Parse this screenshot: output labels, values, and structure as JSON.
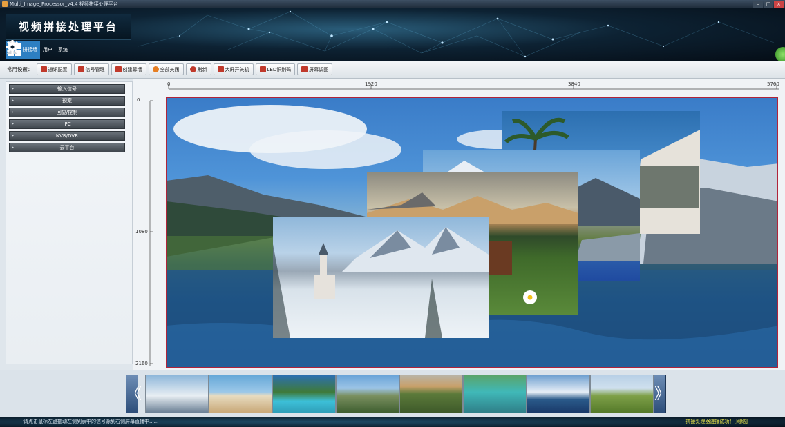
{
  "window": {
    "title": "Multi_Image_Processor_v4.4 视频拼接处理平台",
    "controls": [
      "–",
      "□",
      "×"
    ]
  },
  "header": {
    "brand": "视频拼接处理平台",
    "tabs": [
      {
        "label": "拼接墙",
        "icon": "grid-icon",
        "active": true
      },
      {
        "label": "用户",
        "icon": "user-icon",
        "active": false
      },
      {
        "label": "系统",
        "icon": "gear-icon",
        "active": false
      }
    ]
  },
  "toolbar": {
    "label": "常用设置：",
    "buttons": [
      {
        "label": "通讯配置",
        "icon": "comm-icon",
        "color": "#c0392b"
      },
      {
        "label": "信号管理",
        "icon": "signal-icon",
        "color": "#c0392b"
      },
      {
        "label": "创建幕墙",
        "icon": "wall-icon",
        "color": "#c0392b"
      },
      {
        "label": "全部关闭",
        "icon": "power-icon",
        "color": "#e67e22"
      },
      {
        "label": "刷新",
        "icon": "refresh-icon",
        "color": "#c0392b"
      },
      {
        "label": "大屏开关机",
        "icon": "screen-power-icon",
        "color": "#c0392b"
      },
      {
        "label": "LED识别码",
        "icon": "led-icon",
        "color": "#c0392b"
      },
      {
        "label": "屏幕调图",
        "icon": "screen-adjust-icon",
        "color": "#c0392b"
      }
    ]
  },
  "sidebar": {
    "items": [
      {
        "label": "输入信号"
      },
      {
        "label": "预案"
      },
      {
        "label": "回显/控制"
      },
      {
        "label": "IPC"
      },
      {
        "label": "NVR/DVR"
      },
      {
        "label": "云平台"
      }
    ]
  },
  "rulers": {
    "top_ticks": [
      "0",
      "1920",
      "3840",
      "5760"
    ],
    "left_ticks": [
      "0",
      "1080",
      "2160"
    ]
  },
  "thumbnails": {
    "prev": "《",
    "next": "》",
    "items": [
      {
        "name": "snowy-church",
        "colors": [
          "#8fb7da",
          "#e8eef3",
          "#6b8095"
        ]
      },
      {
        "name": "beach-shell",
        "colors": [
          "#66a8d8",
          "#e8dcc0",
          "#c8a878"
        ]
      },
      {
        "name": "palm-pool",
        "colors": [
          "#2c6fb0",
          "#3f7a3a",
          "#3dc0d8"
        ]
      },
      {
        "name": "mountain-meadow",
        "colors": [
          "#6aa4d8",
          "#7a9060",
          "#3f5f30"
        ]
      },
      {
        "name": "valley-flower",
        "colors": [
          "#b9b4a6",
          "#5c7a3a",
          "#3e5a2a"
        ]
      },
      {
        "name": "turquoise-lake",
        "colors": [
          "#5aa46a",
          "#40b8b8",
          "#2f7f88"
        ]
      },
      {
        "name": "harbor-boats",
        "colors": [
          "#6fa0d0",
          "#e6eef6",
          "#2a5a8a"
        ]
      },
      {
        "name": "green-field",
        "colors": [
          "#b8d0e6",
          "#7ea048",
          "#557a2a"
        ]
      }
    ]
  },
  "status": {
    "left": "请点击鼠标左键拖动左侧列表中的信号源到右侧屏幕直播中......",
    "right": "拼接处理器连接成功！[网络]"
  }
}
